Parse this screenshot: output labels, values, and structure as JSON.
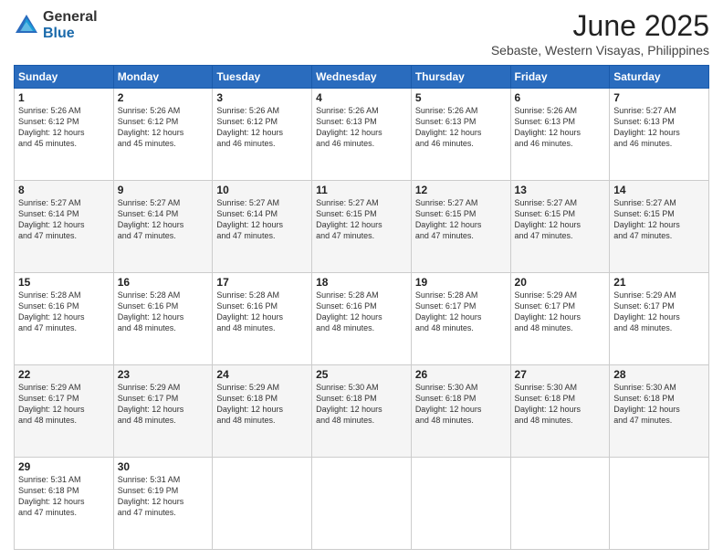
{
  "header": {
    "logo_general": "General",
    "logo_blue": "Blue",
    "month_title": "June 2025",
    "location": "Sebaste, Western Visayas, Philippines"
  },
  "days_of_week": [
    "Sunday",
    "Monday",
    "Tuesday",
    "Wednesday",
    "Thursday",
    "Friday",
    "Saturday"
  ],
  "weeks": [
    [
      {
        "day": "1",
        "info": "Sunrise: 5:26 AM\nSunset: 6:12 PM\nDaylight: 12 hours\nand 45 minutes."
      },
      {
        "day": "2",
        "info": "Sunrise: 5:26 AM\nSunset: 6:12 PM\nDaylight: 12 hours\nand 45 minutes."
      },
      {
        "day": "3",
        "info": "Sunrise: 5:26 AM\nSunset: 6:12 PM\nDaylight: 12 hours\nand 46 minutes."
      },
      {
        "day": "4",
        "info": "Sunrise: 5:26 AM\nSunset: 6:13 PM\nDaylight: 12 hours\nand 46 minutes."
      },
      {
        "day": "5",
        "info": "Sunrise: 5:26 AM\nSunset: 6:13 PM\nDaylight: 12 hours\nand 46 minutes."
      },
      {
        "day": "6",
        "info": "Sunrise: 5:26 AM\nSunset: 6:13 PM\nDaylight: 12 hours\nand 46 minutes."
      },
      {
        "day": "7",
        "info": "Sunrise: 5:27 AM\nSunset: 6:13 PM\nDaylight: 12 hours\nand 46 minutes."
      }
    ],
    [
      {
        "day": "8",
        "info": "Sunrise: 5:27 AM\nSunset: 6:14 PM\nDaylight: 12 hours\nand 47 minutes."
      },
      {
        "day": "9",
        "info": "Sunrise: 5:27 AM\nSunset: 6:14 PM\nDaylight: 12 hours\nand 47 minutes."
      },
      {
        "day": "10",
        "info": "Sunrise: 5:27 AM\nSunset: 6:14 PM\nDaylight: 12 hours\nand 47 minutes."
      },
      {
        "day": "11",
        "info": "Sunrise: 5:27 AM\nSunset: 6:15 PM\nDaylight: 12 hours\nand 47 minutes."
      },
      {
        "day": "12",
        "info": "Sunrise: 5:27 AM\nSunset: 6:15 PM\nDaylight: 12 hours\nand 47 minutes."
      },
      {
        "day": "13",
        "info": "Sunrise: 5:27 AM\nSunset: 6:15 PM\nDaylight: 12 hours\nand 47 minutes."
      },
      {
        "day": "14",
        "info": "Sunrise: 5:27 AM\nSunset: 6:15 PM\nDaylight: 12 hours\nand 47 minutes."
      }
    ],
    [
      {
        "day": "15",
        "info": "Sunrise: 5:28 AM\nSunset: 6:16 PM\nDaylight: 12 hours\nand 47 minutes."
      },
      {
        "day": "16",
        "info": "Sunrise: 5:28 AM\nSunset: 6:16 PM\nDaylight: 12 hours\nand 48 minutes."
      },
      {
        "day": "17",
        "info": "Sunrise: 5:28 AM\nSunset: 6:16 PM\nDaylight: 12 hours\nand 48 minutes."
      },
      {
        "day": "18",
        "info": "Sunrise: 5:28 AM\nSunset: 6:16 PM\nDaylight: 12 hours\nand 48 minutes."
      },
      {
        "day": "19",
        "info": "Sunrise: 5:28 AM\nSunset: 6:17 PM\nDaylight: 12 hours\nand 48 minutes."
      },
      {
        "day": "20",
        "info": "Sunrise: 5:29 AM\nSunset: 6:17 PM\nDaylight: 12 hours\nand 48 minutes."
      },
      {
        "day": "21",
        "info": "Sunrise: 5:29 AM\nSunset: 6:17 PM\nDaylight: 12 hours\nand 48 minutes."
      }
    ],
    [
      {
        "day": "22",
        "info": "Sunrise: 5:29 AM\nSunset: 6:17 PM\nDaylight: 12 hours\nand 48 minutes."
      },
      {
        "day": "23",
        "info": "Sunrise: 5:29 AM\nSunset: 6:17 PM\nDaylight: 12 hours\nand 48 minutes."
      },
      {
        "day": "24",
        "info": "Sunrise: 5:29 AM\nSunset: 6:18 PM\nDaylight: 12 hours\nand 48 minutes."
      },
      {
        "day": "25",
        "info": "Sunrise: 5:30 AM\nSunset: 6:18 PM\nDaylight: 12 hours\nand 48 minutes."
      },
      {
        "day": "26",
        "info": "Sunrise: 5:30 AM\nSunset: 6:18 PM\nDaylight: 12 hours\nand 48 minutes."
      },
      {
        "day": "27",
        "info": "Sunrise: 5:30 AM\nSunset: 6:18 PM\nDaylight: 12 hours\nand 48 minutes."
      },
      {
        "day": "28",
        "info": "Sunrise: 5:30 AM\nSunset: 6:18 PM\nDaylight: 12 hours\nand 47 minutes."
      }
    ],
    [
      {
        "day": "29",
        "info": "Sunrise: 5:31 AM\nSunset: 6:18 PM\nDaylight: 12 hours\nand 47 minutes."
      },
      {
        "day": "30",
        "info": "Sunrise: 5:31 AM\nSunset: 6:19 PM\nDaylight: 12 hours\nand 47 minutes."
      },
      {
        "day": "",
        "info": ""
      },
      {
        "day": "",
        "info": ""
      },
      {
        "day": "",
        "info": ""
      },
      {
        "day": "",
        "info": ""
      },
      {
        "day": "",
        "info": ""
      }
    ]
  ]
}
